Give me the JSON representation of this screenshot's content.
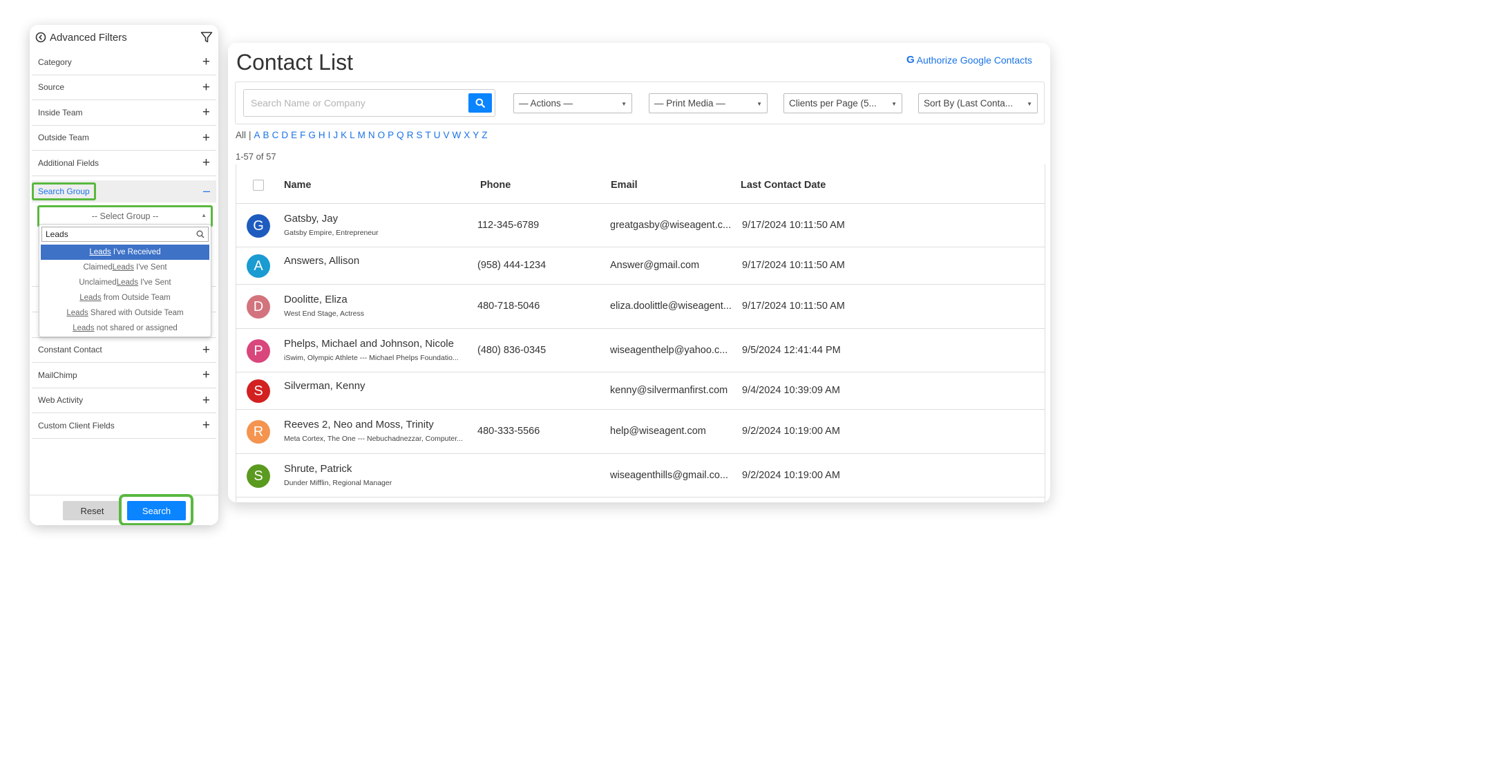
{
  "filters": {
    "title": "Advanced Filters",
    "items": [
      {
        "label": "Category"
      },
      {
        "label": "Source"
      },
      {
        "label": "Inside Team"
      },
      {
        "label": "Outside Team"
      },
      {
        "label": "Additional Fields"
      }
    ],
    "search_group": {
      "label": "Search Group",
      "select_placeholder": "-- Select Group --",
      "dropdown_search_value": "Leads",
      "options": [
        {
          "pre": "",
          "hl": "Leads",
          "post": " I've Received"
        },
        {
          "pre": "Claimed ",
          "hl": "Leads",
          "post": " I've Sent"
        },
        {
          "pre": "Unclaimed ",
          "hl": "Leads",
          "post": " I've Sent"
        },
        {
          "pre": "",
          "hl": "Leads",
          "post": " from Outside Team"
        },
        {
          "pre": "",
          "hl": "Leads",
          "post": " Shared with Outside Team"
        },
        {
          "pre": "",
          "hl": "Leads",
          "post": " not shared or assigned"
        }
      ]
    },
    "items_after": [
      {
        "label": "Constant Contact"
      },
      {
        "label": "MailChimp"
      },
      {
        "label": "Web Activity"
      },
      {
        "label": "Custom Client Fields"
      }
    ],
    "reset_label": "Reset",
    "search_label": "Search"
  },
  "main": {
    "title": "Contact List",
    "google_link": "Authorize Google Contacts",
    "search_placeholder": "Search Name or Company",
    "actions": "— Actions —",
    "print_media": "— Print Media —",
    "per_page": "Clients per Page (5...",
    "sort_by": "Sort By (Last Conta...",
    "alpha_all": "All",
    "alpha_sep": "|",
    "letters": [
      "A",
      "B",
      "C",
      "D",
      "E",
      "F",
      "G",
      "H",
      "I",
      "J",
      "K",
      "L",
      "M",
      "N",
      "O",
      "P",
      "Q",
      "R",
      "S",
      "T",
      "U",
      "V",
      "W",
      "X",
      "Y",
      "Z"
    ],
    "count": "1-57 of 57",
    "columns": {
      "name": "Name",
      "phone": "Phone",
      "email": "Email",
      "last_contact": "Last Contact Date"
    },
    "rows": [
      {
        "initial": "G",
        "color": "#1d5bbf",
        "name": "Gatsby, Jay",
        "sub": "Gatsby Empire, Entrepreneur",
        "phone": "112-345-6789",
        "email": "greatgasby@wiseagent.c...",
        "date": "9/17/2024 10:11:50 AM"
      },
      {
        "initial": "A",
        "color": "#1a9bd1",
        "name": "Answers, Allison",
        "sub": "",
        "phone": "(958) 444-1234",
        "email": "Answer@gmail.com",
        "date": "9/17/2024 10:11:50 AM"
      },
      {
        "initial": "D",
        "color": "#d2737d",
        "name": "Doolitte, Eliza",
        "sub": "West End Stage, Actress",
        "phone": "480-718-5046",
        "email": "eliza.doolittle@wiseagent...",
        "date": "9/17/2024 10:11:50 AM"
      },
      {
        "initial": "P",
        "color": "#d9467c",
        "name": "Phelps, Michael and Johnson, Nicole",
        "sub": "iSwim, Olympic Athlete --- Michael Phelps Foundatio...",
        "phone": "(480) 836-0345",
        "email": "wiseagenthelp@yahoo.c...",
        "date": "9/5/2024 12:41:44 PM"
      },
      {
        "initial": "S",
        "color": "#d32020",
        "name": "Silverman, Kenny",
        "sub": "",
        "phone": "",
        "email": "kenny@silvermanfirst.com",
        "date": "9/4/2024 10:39:09 AM"
      },
      {
        "initial": "R",
        "color": "#f4944e",
        "name": "Reeves 2, Neo and Moss, Trinity",
        "sub": "Meta Cortex, The One --- Nebuchadnezzar, Computer...",
        "phone": "480-333-5566",
        "email": "help@wiseagent.com",
        "date": "9/2/2024 10:19:00 AM"
      },
      {
        "initial": "S",
        "color": "#5a9a1f",
        "name": "Shrute, Patrick",
        "sub": "Dunder Mifflin, Regional Manager",
        "phone": "",
        "email": "wiseagenthills@gmail.co...",
        "date": "9/2/2024 10:19:00 AM"
      }
    ]
  }
}
